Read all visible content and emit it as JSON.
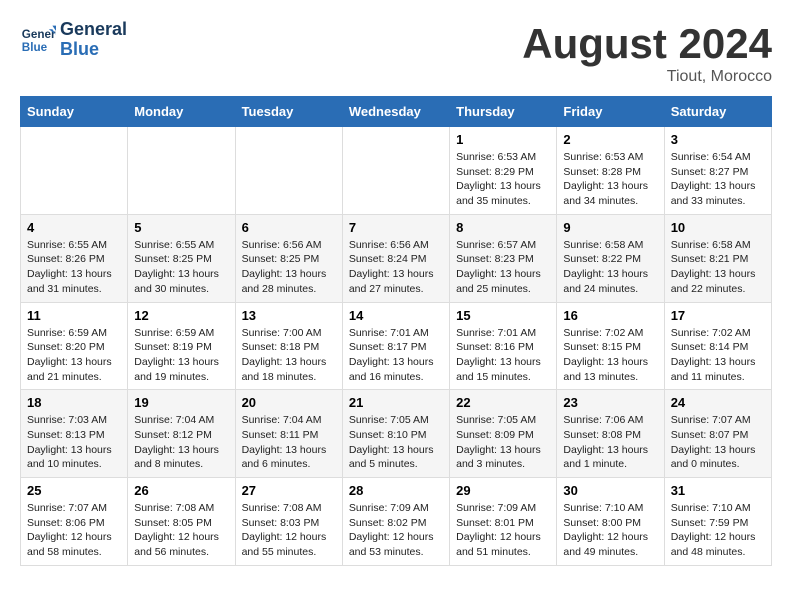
{
  "header": {
    "logo_general": "General",
    "logo_blue": "Blue",
    "month_title": "August 2024",
    "location": "Tiout, Morocco"
  },
  "weekdays": [
    "Sunday",
    "Monday",
    "Tuesday",
    "Wednesday",
    "Thursday",
    "Friday",
    "Saturday"
  ],
  "weeks": [
    [
      {
        "day": "",
        "info": ""
      },
      {
        "day": "",
        "info": ""
      },
      {
        "day": "",
        "info": ""
      },
      {
        "day": "",
        "info": ""
      },
      {
        "day": "1",
        "info": "Sunrise: 6:53 AM\nSunset: 8:29 PM\nDaylight: 13 hours\nand 35 minutes."
      },
      {
        "day": "2",
        "info": "Sunrise: 6:53 AM\nSunset: 8:28 PM\nDaylight: 13 hours\nand 34 minutes."
      },
      {
        "day": "3",
        "info": "Sunrise: 6:54 AM\nSunset: 8:27 PM\nDaylight: 13 hours\nand 33 minutes."
      }
    ],
    [
      {
        "day": "4",
        "info": "Sunrise: 6:55 AM\nSunset: 8:26 PM\nDaylight: 13 hours\nand 31 minutes."
      },
      {
        "day": "5",
        "info": "Sunrise: 6:55 AM\nSunset: 8:25 PM\nDaylight: 13 hours\nand 30 minutes."
      },
      {
        "day": "6",
        "info": "Sunrise: 6:56 AM\nSunset: 8:25 PM\nDaylight: 13 hours\nand 28 minutes."
      },
      {
        "day": "7",
        "info": "Sunrise: 6:56 AM\nSunset: 8:24 PM\nDaylight: 13 hours\nand 27 minutes."
      },
      {
        "day": "8",
        "info": "Sunrise: 6:57 AM\nSunset: 8:23 PM\nDaylight: 13 hours\nand 25 minutes."
      },
      {
        "day": "9",
        "info": "Sunrise: 6:58 AM\nSunset: 8:22 PM\nDaylight: 13 hours\nand 24 minutes."
      },
      {
        "day": "10",
        "info": "Sunrise: 6:58 AM\nSunset: 8:21 PM\nDaylight: 13 hours\nand 22 minutes."
      }
    ],
    [
      {
        "day": "11",
        "info": "Sunrise: 6:59 AM\nSunset: 8:20 PM\nDaylight: 13 hours\nand 21 minutes."
      },
      {
        "day": "12",
        "info": "Sunrise: 6:59 AM\nSunset: 8:19 PM\nDaylight: 13 hours\nand 19 minutes."
      },
      {
        "day": "13",
        "info": "Sunrise: 7:00 AM\nSunset: 8:18 PM\nDaylight: 13 hours\nand 18 minutes."
      },
      {
        "day": "14",
        "info": "Sunrise: 7:01 AM\nSunset: 8:17 PM\nDaylight: 13 hours\nand 16 minutes."
      },
      {
        "day": "15",
        "info": "Sunrise: 7:01 AM\nSunset: 8:16 PM\nDaylight: 13 hours\nand 15 minutes."
      },
      {
        "day": "16",
        "info": "Sunrise: 7:02 AM\nSunset: 8:15 PM\nDaylight: 13 hours\nand 13 minutes."
      },
      {
        "day": "17",
        "info": "Sunrise: 7:02 AM\nSunset: 8:14 PM\nDaylight: 13 hours\nand 11 minutes."
      }
    ],
    [
      {
        "day": "18",
        "info": "Sunrise: 7:03 AM\nSunset: 8:13 PM\nDaylight: 13 hours\nand 10 minutes."
      },
      {
        "day": "19",
        "info": "Sunrise: 7:04 AM\nSunset: 8:12 PM\nDaylight: 13 hours\nand 8 minutes."
      },
      {
        "day": "20",
        "info": "Sunrise: 7:04 AM\nSunset: 8:11 PM\nDaylight: 13 hours\nand 6 minutes."
      },
      {
        "day": "21",
        "info": "Sunrise: 7:05 AM\nSunset: 8:10 PM\nDaylight: 13 hours\nand 5 minutes."
      },
      {
        "day": "22",
        "info": "Sunrise: 7:05 AM\nSunset: 8:09 PM\nDaylight: 13 hours\nand 3 minutes."
      },
      {
        "day": "23",
        "info": "Sunrise: 7:06 AM\nSunset: 8:08 PM\nDaylight: 13 hours\nand 1 minute."
      },
      {
        "day": "24",
        "info": "Sunrise: 7:07 AM\nSunset: 8:07 PM\nDaylight: 13 hours\nand 0 minutes."
      }
    ],
    [
      {
        "day": "25",
        "info": "Sunrise: 7:07 AM\nSunset: 8:06 PM\nDaylight: 12 hours\nand 58 minutes."
      },
      {
        "day": "26",
        "info": "Sunrise: 7:08 AM\nSunset: 8:05 PM\nDaylight: 12 hours\nand 56 minutes."
      },
      {
        "day": "27",
        "info": "Sunrise: 7:08 AM\nSunset: 8:03 PM\nDaylight: 12 hours\nand 55 minutes."
      },
      {
        "day": "28",
        "info": "Sunrise: 7:09 AM\nSunset: 8:02 PM\nDaylight: 12 hours\nand 53 minutes."
      },
      {
        "day": "29",
        "info": "Sunrise: 7:09 AM\nSunset: 8:01 PM\nDaylight: 12 hours\nand 51 minutes."
      },
      {
        "day": "30",
        "info": "Sunrise: 7:10 AM\nSunset: 8:00 PM\nDaylight: 12 hours\nand 49 minutes."
      },
      {
        "day": "31",
        "info": "Sunrise: 7:10 AM\nSunset: 7:59 PM\nDaylight: 12 hours\nand 48 minutes."
      }
    ]
  ]
}
